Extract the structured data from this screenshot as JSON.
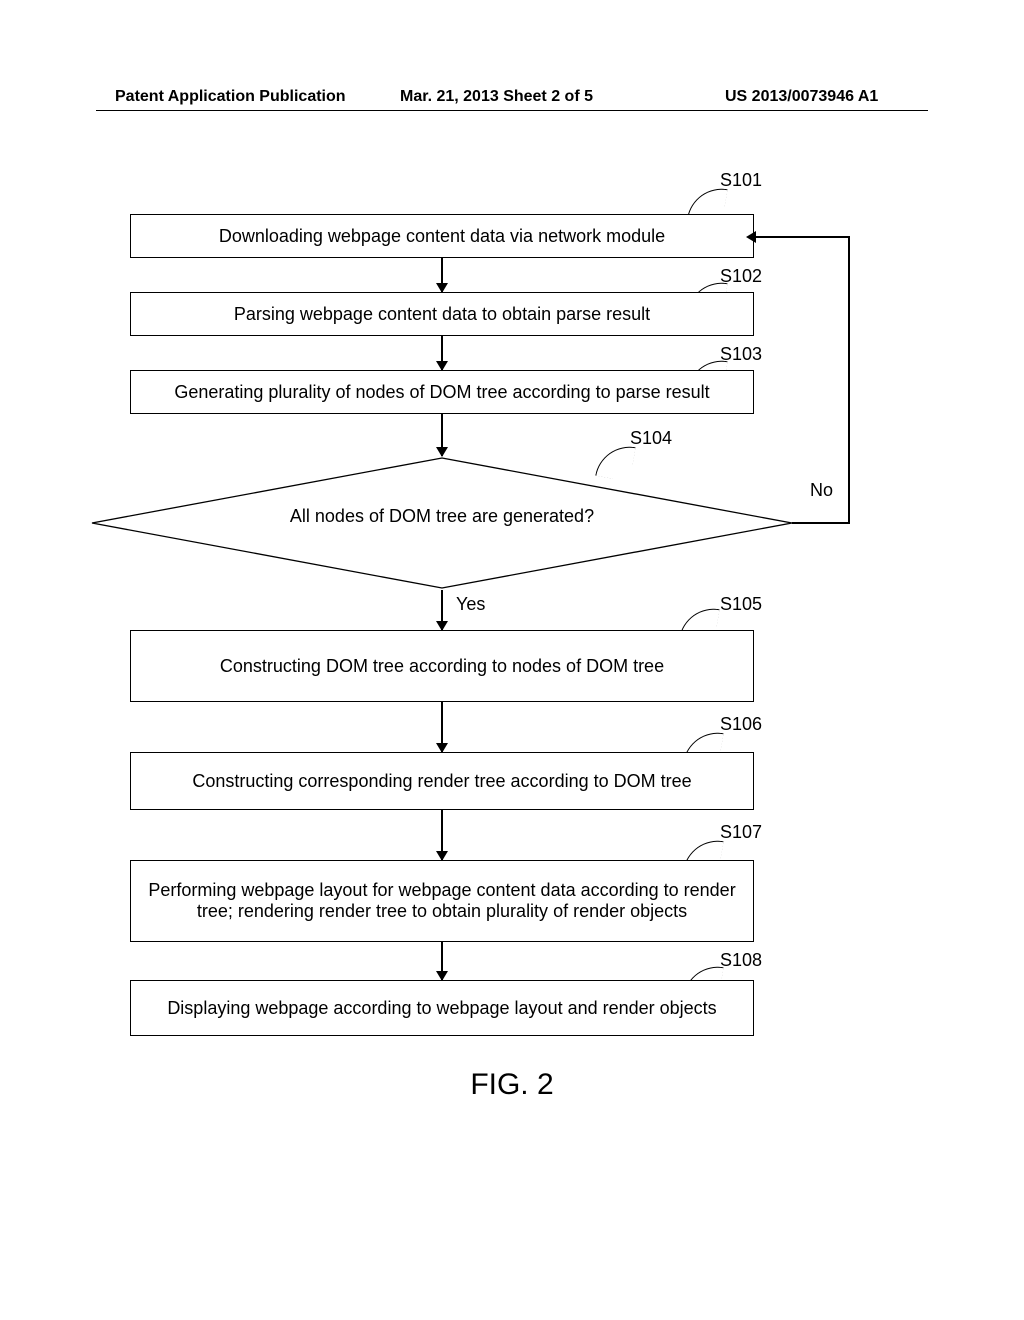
{
  "header": {
    "left": "Patent Application Publication",
    "middle": "Mar. 21, 2013  Sheet 2 of 5",
    "right": "US 2013/0073946 A1"
  },
  "figure_label": "FIG. 2",
  "steps": {
    "s101": {
      "label": "S101",
      "text": "Downloading webpage content data via network module"
    },
    "s102": {
      "label": "S102",
      "text": "Parsing webpage content data to obtain parse result"
    },
    "s103": {
      "label": "S103",
      "text": "Generating plurality of nodes of DOM tree according to parse result"
    },
    "s104": {
      "label": "S104",
      "text": "All nodes of DOM tree are generated?"
    },
    "s105": {
      "label": "S105",
      "text": "Constructing DOM tree according to nodes of DOM tree"
    },
    "s106": {
      "label": "S106",
      "text": "Constructing corresponding render tree according to DOM tree"
    },
    "s107": {
      "label": "S107",
      "text": "Performing webpage layout for webpage content data according to render tree; rendering render tree to obtain plurality of render objects"
    },
    "s108": {
      "label": "S108",
      "text": "Displaying webpage according to webpage layout and render objects"
    }
  },
  "decision": {
    "yes": "Yes",
    "no": "No"
  },
  "chart_data": {
    "type": "flowchart",
    "nodes": [
      {
        "id": "S101",
        "kind": "process",
        "text": "Downloading webpage content data via network module"
      },
      {
        "id": "S102",
        "kind": "process",
        "text": "Parsing webpage content data to obtain parse result"
      },
      {
        "id": "S103",
        "kind": "process",
        "text": "Generating plurality of nodes of DOM tree according to parse result"
      },
      {
        "id": "S104",
        "kind": "decision",
        "text": "All nodes of DOM tree are generated?"
      },
      {
        "id": "S105",
        "kind": "process",
        "text": "Constructing DOM tree according to nodes of DOM tree"
      },
      {
        "id": "S106",
        "kind": "process",
        "text": "Constructing corresponding render tree according to DOM tree"
      },
      {
        "id": "S107",
        "kind": "process",
        "text": "Performing webpage layout for webpage content data according to render tree; rendering render tree to obtain plurality of render objects"
      },
      {
        "id": "S108",
        "kind": "process",
        "text": "Displaying webpage according to webpage layout and render objects"
      }
    ],
    "edges": [
      {
        "from": "S101",
        "to": "S102"
      },
      {
        "from": "S102",
        "to": "S103"
      },
      {
        "from": "S103",
        "to": "S104"
      },
      {
        "from": "S104",
        "to": "S105",
        "label": "Yes"
      },
      {
        "from": "S104",
        "to": "S101",
        "label": "No"
      },
      {
        "from": "S105",
        "to": "S106"
      },
      {
        "from": "S106",
        "to": "S107"
      },
      {
        "from": "S107",
        "to": "S108"
      }
    ]
  }
}
